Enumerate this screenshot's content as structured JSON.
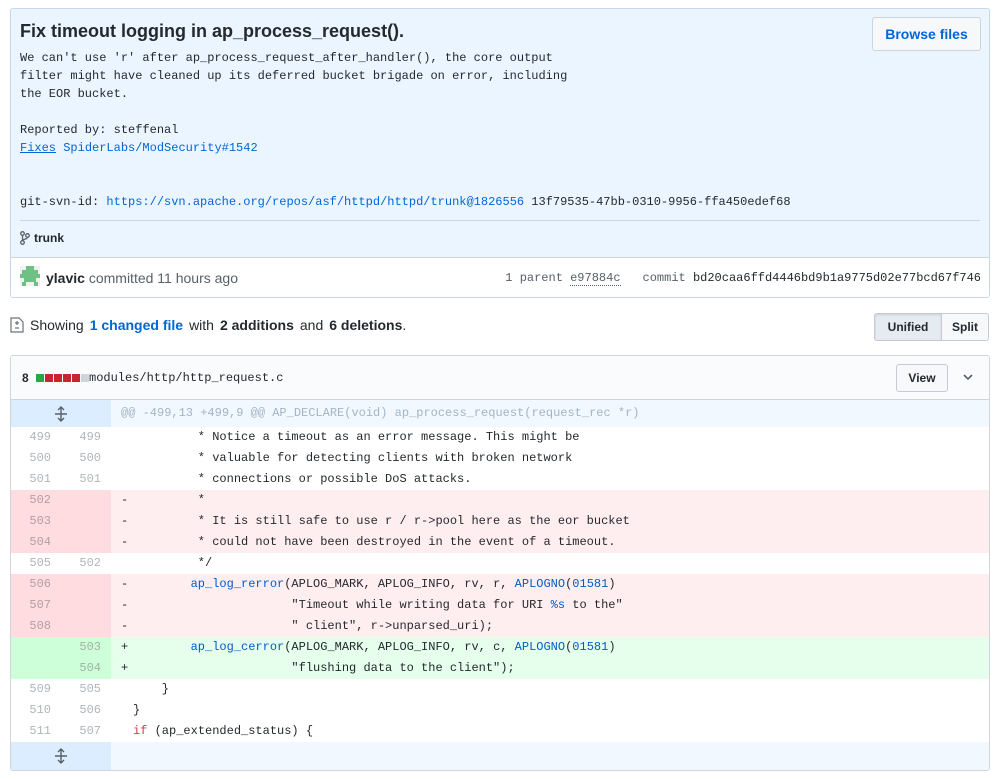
{
  "commit": {
    "title": "Fix timeout logging in ap_process_request().",
    "browse_files": "Browse files",
    "desc_line1": "We can't use 'r' after ap_process_request_after_handler(), the core output",
    "desc_line2": "filter might have cleaned up its deferred bucket brigade on error, including",
    "desc_line3": "the EOR bucket.",
    "reported_by": "Reported by: steffenal",
    "fixes_word": "Fixes",
    "fixes_link": "SpiderLabs/ModSecurity#1542",
    "svn_label": "git-svn-id:",
    "svn_link": "https://svn.apache.org/repos/asf/httpd/httpd/trunk@1826556",
    "svn_rest": "13f79535-47bb-0310-9956-ffa450edef68",
    "branch": "trunk",
    "author": "ylavic",
    "committed": "committed 11 hours ago",
    "parent_label": "1 parent",
    "parent_sha": "e97884c",
    "commit_label": "commit",
    "commit_sha": "bd20caa6ffd4446bd9b1a9775d02e77bcd67f746"
  },
  "toolbar": {
    "showing": "Showing",
    "changed": "1 changed file",
    "with": "with",
    "additions": "2 additions",
    "and": "and",
    "deletions": "6 deletions",
    "period": ".",
    "unified": "Unified",
    "split": "Split"
  },
  "file": {
    "count": "8",
    "path": "modules/http/http_request.c",
    "view": "View",
    "blocks": [
      "#28a745",
      "#cb2431",
      "#cb2431",
      "#cb2431",
      "#cb2431",
      "#d1d5da"
    ]
  },
  "diff": {
    "hunk": "@@ -499,13 +499,9 @@ AP_DECLARE(void) ap_process_request(request_rec *r)",
    "rows": [
      {
        "n1": "499",
        "n2": "499",
        "sign": "",
        "code": "         * Notice a timeout as an error message. This might be"
      },
      {
        "n1": "500",
        "n2": "500",
        "sign": "",
        "code": "         * valuable for detecting clients with broken network"
      },
      {
        "n1": "501",
        "n2": "501",
        "sign": "",
        "code": "         * connections or possible DoS attacks."
      },
      {
        "n1": "502",
        "n2": "",
        "sign": "-",
        "code": "         *"
      },
      {
        "n1": "503",
        "n2": "",
        "sign": "-",
        "code": "         * It is still safe to use r / r->pool here as the eor bucket"
      },
      {
        "n1": "504",
        "n2": "",
        "sign": "-",
        "code": "         * could not have been destroyed in the event of a timeout."
      },
      {
        "n1": "505",
        "n2": "502",
        "sign": "",
        "code": "         */"
      },
      {
        "n1": "506",
        "n2": "",
        "sign": "-",
        "code": "        ap_log_rerror(APLOG_MARK, APLOG_INFO, rv, r, APLOGNO(01581)"
      },
      {
        "n1": "507",
        "n2": "",
        "sign": "-",
        "code": "                      \"Timeout while writing data for URI %s to the\""
      },
      {
        "n1": "508",
        "n2": "",
        "sign": "-",
        "code": "                      \" client\", r->unparsed_uri);"
      },
      {
        "n1": "",
        "n2": "503",
        "sign": "+",
        "code": "        ap_log_cerror(APLOG_MARK, APLOG_INFO, rv, c, APLOGNO(01581)"
      },
      {
        "n1": "",
        "n2": "504",
        "sign": "+",
        "code": "                      \"flushing data to the client\");"
      },
      {
        "n1": "509",
        "n2": "505",
        "sign": "",
        "code": "    }"
      },
      {
        "n1": "510",
        "n2": "506",
        "sign": "",
        "code": "}"
      },
      {
        "n1": "511",
        "n2": "507",
        "sign": "",
        "code": "if (ap_extended_status) {"
      }
    ],
    "row_types": [
      "ctx",
      "ctx",
      "ctx",
      "del",
      "del",
      "del",
      "ctx",
      "del",
      "del",
      "del",
      "add",
      "add",
      "ctx",
      "ctx",
      "ctx"
    ]
  }
}
